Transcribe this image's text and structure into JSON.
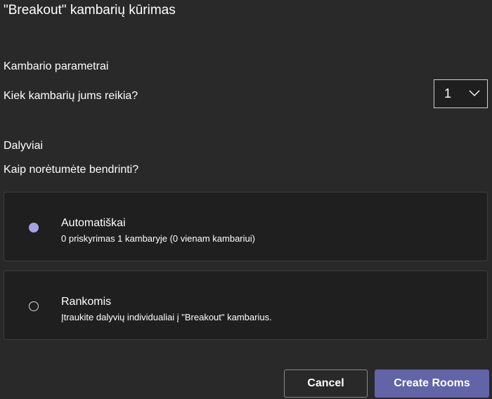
{
  "dialog": {
    "title": "\"Breakout\" kambarių kūrimas"
  },
  "room_settings": {
    "heading": "Kambario parametrai",
    "question": "Kiek kambarių jums reikia?",
    "room_count": "1"
  },
  "participants": {
    "heading": "Dalyviai",
    "question": "Kaip norėtumėte bendrinti?",
    "options": [
      {
        "title": "Automatiškai",
        "description": "0 priskyrimas 1 kambaryje (0 vienam kambariui)",
        "selected": true
      },
      {
        "title": "Rankomis",
        "description": "Įtraukite dalyvių individualiai į \"Breakout\" kambarius.",
        "selected": false
      }
    ]
  },
  "footer": {
    "cancel_label": "Cancel",
    "create_label": "Create Rooms"
  },
  "colors": {
    "background": "#292929",
    "card": "#1f1f1f",
    "accent": "#6264a7",
    "radio_selected": "#a6a2e3"
  },
  "icons": {
    "select_arrow": "chevron-down-icon"
  }
}
